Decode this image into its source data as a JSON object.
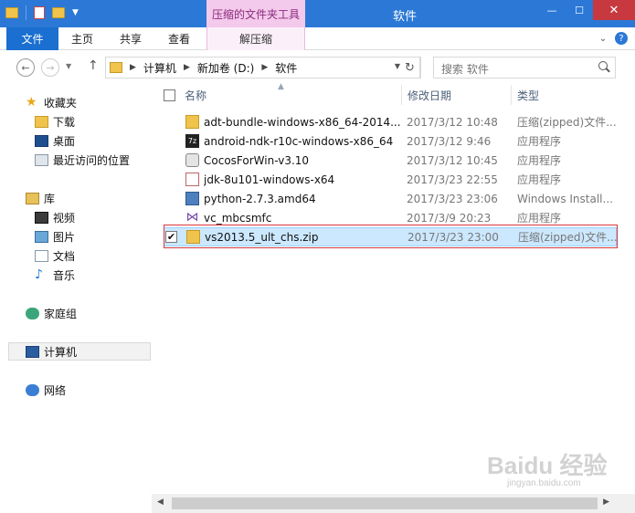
{
  "window": {
    "title": "软件",
    "contextual_tab_title": "压缩的文件夹工具",
    "controls": {
      "minimize": "—",
      "maximize": "☐",
      "close": "✕"
    }
  },
  "ribbon": {
    "tabs": [
      {
        "label": "文件"
      },
      {
        "label": "主页"
      },
      {
        "label": "共享"
      },
      {
        "label": "查看"
      },
      {
        "label": "解压缩"
      }
    ],
    "expand_glyph": "⌄",
    "help_glyph": "?"
  },
  "address": {
    "crumbs": [
      "计算机",
      "新加卷 (D:)",
      "软件"
    ]
  },
  "search": {
    "placeholder": "搜索 软件"
  },
  "navpane": {
    "favorites": {
      "label": "收藏夹",
      "items": [
        {
          "label": "下载"
        },
        {
          "label": "桌面"
        },
        {
          "label": "最近访问的位置"
        }
      ]
    },
    "libraries": {
      "label": "库",
      "items": [
        {
          "label": "视频"
        },
        {
          "label": "图片"
        },
        {
          "label": "文档"
        },
        {
          "label": "音乐"
        }
      ]
    },
    "homegroup": {
      "label": "家庭组"
    },
    "computer": {
      "label": "计算机"
    },
    "network": {
      "label": "网络"
    }
  },
  "filelist": {
    "columns": {
      "name": "名称",
      "date": "修改日期",
      "type": "类型"
    },
    "rows": [
      {
        "name": "adt-bundle-windows-x86_64-2014...",
        "date": "2017/3/12 10:48",
        "type": "压缩(zipped)文件...",
        "icon": "zip-icon"
      },
      {
        "name": "android-ndk-r10c-windows-x86_64",
        "date": "2017/3/12 9:46",
        "type": "应用程序",
        "icon": "7z-icon"
      },
      {
        "name": "CocosForWin-v3.10",
        "date": "2017/3/12 10:45",
        "type": "应用程序",
        "icon": "cocos-icon"
      },
      {
        "name": "jdk-8u101-windows-x64",
        "date": "2017/3/23 22:55",
        "type": "应用程序",
        "icon": "java-icon"
      },
      {
        "name": "python-2.7.3.amd64",
        "date": "2017/3/23 23:06",
        "type": "Windows Install...",
        "icon": "python-icon"
      },
      {
        "name": "vc_mbcsmfc",
        "date": "2017/3/9 20:23",
        "type": "应用程序",
        "icon": "visual-studio-icon"
      },
      {
        "name": "vs2013.5_ult_chs.zip",
        "date": "2017/3/23 23:00",
        "type": "压缩(zipped)文件...",
        "icon": "zip-icon",
        "selected": true
      }
    ]
  },
  "watermark": {
    "main": "Baidu 经验",
    "sub": "jingyan.baidu.com"
  }
}
